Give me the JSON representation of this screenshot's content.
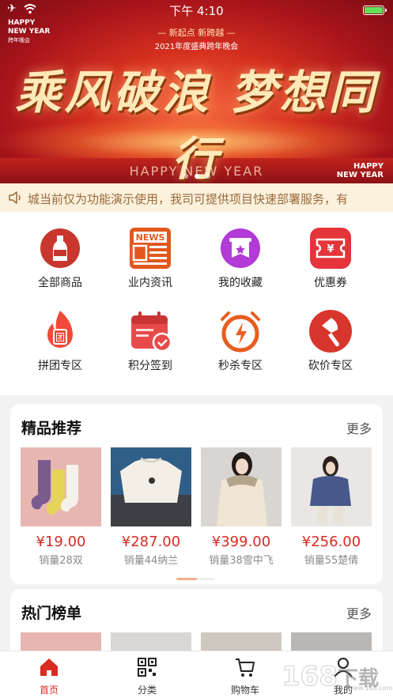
{
  "status_bar": {
    "time": "下午 4:10"
  },
  "banner": {
    "corner_top_left": "HAPPY\nNEW YEAR",
    "corner_top_left_sub": "跨年晚会",
    "subtitle": "— 新起点  新跨越 —",
    "subtitle2": "2021年度盛典跨年晚会",
    "title": "乘风破浪  梦想同行",
    "bottom_text": "HAPPY NEW YEAR",
    "corner_bottom_right": "HAPPY\nNEW YEAR",
    "slide_count": 3,
    "active_slide": 2
  },
  "notice": {
    "text": "城当前仅为功能演示使用，我司可提供项目快速部署服务，有"
  },
  "quick_menu": [
    {
      "label": "全部商品",
      "icon": "wine-bottle-icon"
    },
    {
      "label": "业内资讯",
      "icon": "news-icon"
    },
    {
      "label": "我的收藏",
      "icon": "favorite-flag-icon"
    },
    {
      "label": "优惠券",
      "icon": "coupon-icon"
    },
    {
      "label": "拼团专区",
      "icon": "group-buy-flame-icon"
    },
    {
      "label": "积分签到",
      "icon": "calendar-check-icon"
    },
    {
      "label": "秒杀专区",
      "icon": "flash-alarm-icon"
    },
    {
      "label": "砍价专区",
      "icon": "bargain-knife-icon"
    }
  ],
  "featured": {
    "title": "精品推荐",
    "more": "更多",
    "products": [
      {
        "price": "¥19.00",
        "sales": "销量28双"
      },
      {
        "price": "¥287.00",
        "sales": "销量44纳兰"
      },
      {
        "price": "¥399.00",
        "sales": "销量38雪中飞"
      },
      {
        "price": "¥256.00",
        "sales": "销量55楚倩"
      }
    ]
  },
  "hot": {
    "title": "热门榜单",
    "more": "更多"
  },
  "tabbar": [
    {
      "label": "首页",
      "active": true
    },
    {
      "label": "分类"
    },
    {
      "label": "购物车"
    },
    {
      "label": "我的"
    }
  ],
  "watermark": {
    "text": "168",
    "suffix": "下载",
    "url": "www.168.com"
  },
  "colors": {
    "accent": "#d92b22",
    "notice_bg": "#fbf1dd",
    "notice_text": "#9a6a3a"
  }
}
